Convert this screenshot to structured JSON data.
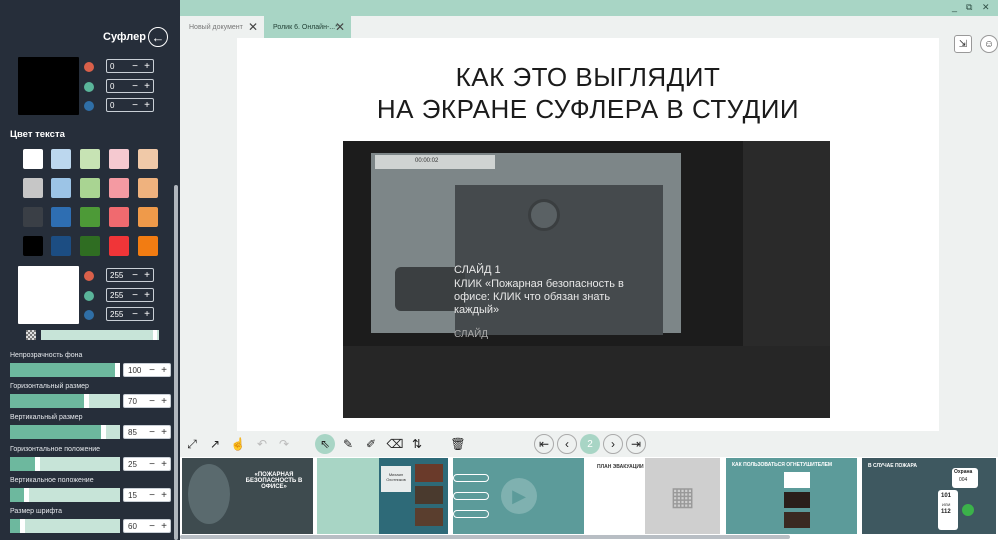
{
  "colors": {
    "accent": "#6db89e",
    "sidebar": "#262e3a",
    "topbar": "#a8d5c5"
  },
  "sidebar": {
    "title": "Суфлер",
    "back_icon": "arrow-left-icon",
    "bg_rgb": [
      "0",
      "0",
      "0"
    ],
    "text_color_section": "Цвет текста",
    "text_rgb": [
      "255",
      "255",
      "255"
    ],
    "palette": [
      [
        "#ffffff",
        "#bcd7ee",
        "#c7e3b4",
        "#f5c9d0",
        "#f0c9a8"
      ],
      [
        "#c6c6c6",
        "#9cc4e6",
        "#a9d492",
        "#f49aa2",
        "#efb27e"
      ],
      [
        "#3a3f46",
        "#2e6eb2",
        "#4d9a37",
        "#f06a6f",
        "#ef9a4a"
      ],
      [
        "#000000",
        "#1c4d82",
        "#2f6d22",
        "#f03538",
        "#f27c12"
      ]
    ],
    "sliders": [
      {
        "label": "Непрозрачность фона",
        "value": "100",
        "level": 1.0
      },
      {
        "label": "Горизонтальный размер",
        "value": "70",
        "level": 0.7
      },
      {
        "label": "Вертикальный размер",
        "value": "85",
        "level": 0.85
      },
      {
        "label": "Горизонтальное положение",
        "value": "25",
        "level": 0.25
      },
      {
        "label": "Вертикальное положение",
        "value": "15",
        "level": 0.15
      },
      {
        "label": "Размер шрифта",
        "value": "60",
        "level": 0.12
      }
    ]
  },
  "tabs": [
    {
      "label": "Новый документ"
    },
    {
      "label": "Ролик 6. Онлайн-...*"
    }
  ],
  "window": {
    "minimize": "_",
    "restore": "⧉",
    "close": "✕"
  },
  "slide": {
    "title_line1": "КАК ЭТО ВЫГЛЯДИТ",
    "title_line2": "НА ЭКРАНЕ СУФЛЕРА В СТУДИИ",
    "photo": {
      "timer": "00:00:02",
      "slide_label": "СЛАЙД 1",
      "text": "КЛИК «Пожарная безопасность в офисе: КЛИК что обязан знать каждый»",
      "bottom_text": "СЛАЙД"
    }
  },
  "pager": {
    "current": "2"
  },
  "thumbs": [
    {
      "text": "«ПОЖАРНАЯ БЕЗОПАСНОСТЬ В ОФИСЕ»"
    },
    {
      "text": "Михаил Охотников"
    },
    {
      "text": ""
    },
    {
      "text": "ПЛАН ЭВАКУАЦИИ"
    },
    {
      "text": "КАК ПОЛЬЗОВАТЬСЯ ОГНЕТУШИТЕЛЕМ"
    },
    {
      "text": "В СЛУЧАЕ ПОЖАРА",
      "badge1": "Охрана",
      "badge2": "004",
      "badge3": "101",
      "badge4": "ИЛИ",
      "badge5": "112"
    }
  ]
}
